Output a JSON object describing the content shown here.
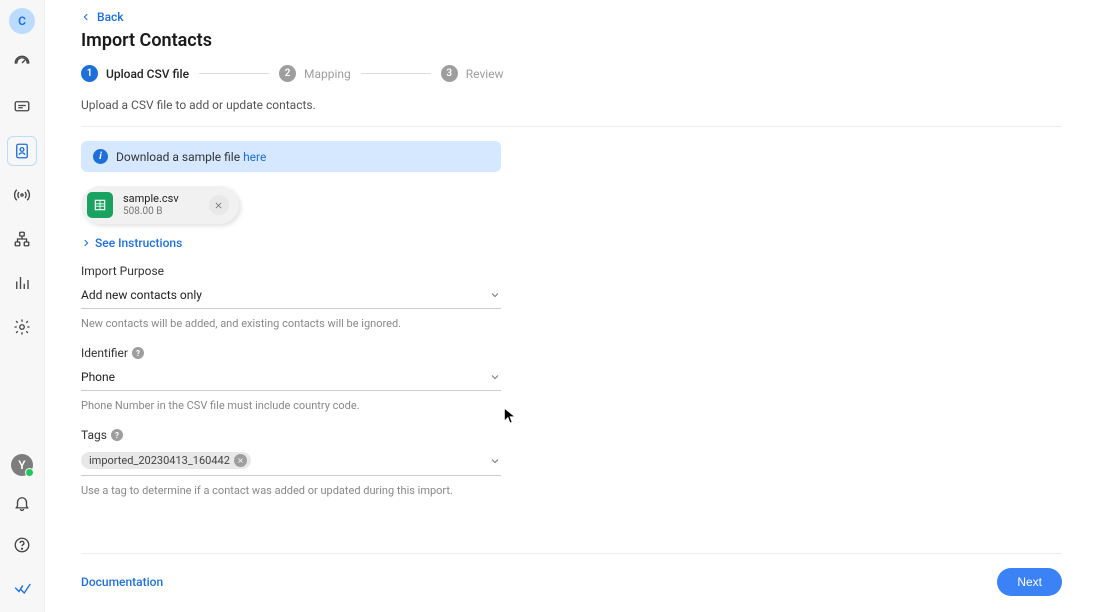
{
  "sidebar": {
    "top_avatar": "C",
    "bottom_avatar": "Y"
  },
  "header": {
    "back_label": "Back",
    "title": "Import Contacts"
  },
  "stepper": {
    "steps": [
      {
        "num": "1",
        "label": "Upload CSV file"
      },
      {
        "num": "2",
        "label": "Mapping"
      },
      {
        "num": "3",
        "label": "Review"
      }
    ]
  },
  "description": "Upload a CSV file to add or update contacts.",
  "banner": {
    "text": "Download a sample file ",
    "link": "here"
  },
  "file": {
    "name": "sample.csv",
    "size": "508.00 B"
  },
  "instructions_label": "See Instructions",
  "fields": {
    "purpose": {
      "label": "Import Purpose",
      "value": "Add new contacts only",
      "help": "New contacts will be added, and existing contacts will be ignored."
    },
    "identifier": {
      "label": "Identifier",
      "value": "Phone",
      "help": "Phone Number in the CSV file must include country code."
    },
    "tags": {
      "label": "Tags",
      "value": "imported_20230413_160442",
      "help": "Use a tag to determine if a contact was added or updated during this import."
    }
  },
  "footer": {
    "doc_label": "Documentation",
    "next_label": "Next"
  }
}
